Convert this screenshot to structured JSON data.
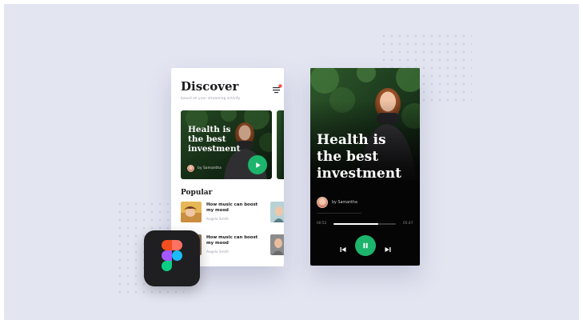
{
  "discover": {
    "title": "Discover",
    "subtitle": "based on your streaming activity",
    "featured": {
      "title": "Health is the best investment",
      "author": "by Samantha"
    },
    "popular_title": "Popular",
    "popular_items": [
      {
        "title": "How music can boost my mood",
        "author": "Angela Smith"
      },
      {
        "title": "How music can boost my mood",
        "author": "Angela Smith"
      }
    ]
  },
  "player": {
    "title": "Health is the best investment",
    "author": "by Samantha",
    "current_time": "00:52",
    "duration": "05:47",
    "progress": 0.72
  },
  "icons": {
    "filter": "filter-icon",
    "play": "play-icon",
    "pause": "pause-icon",
    "previous": "skip-previous-icon",
    "next": "skip-next-icon",
    "figma": "figma-logo"
  },
  "colors": {
    "accent": "#1db46b",
    "filter_dot": "#ff4b4b",
    "background": "#e3e5f1"
  }
}
